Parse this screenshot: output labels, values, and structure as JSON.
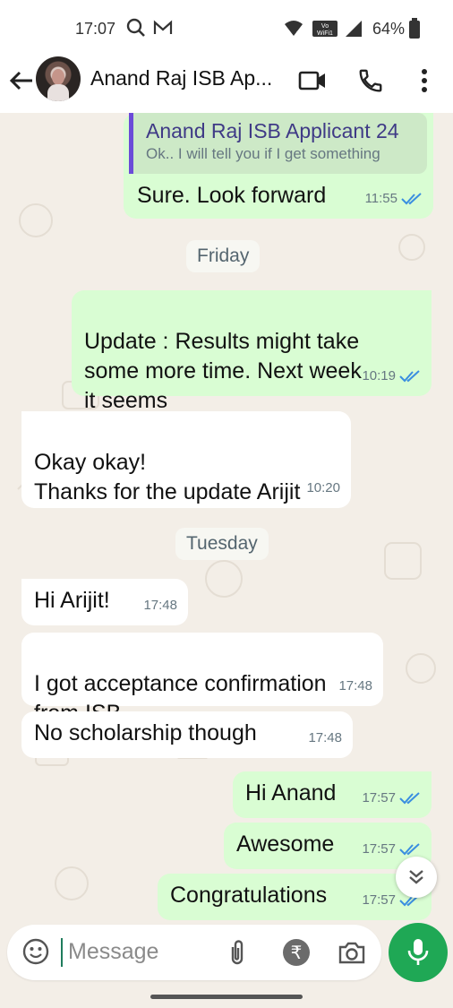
{
  "status_bar": {
    "time": "17:07",
    "battery": "64%",
    "icons": [
      "search-icon",
      "mail-icon",
      "wifi-icon",
      "vowifi-icon",
      "signal-icon",
      "battery-icon"
    ]
  },
  "header": {
    "contact_name": "Anand Raj ISB Ap...",
    "icons": [
      "back-arrow-icon",
      "video-call-icon",
      "phone-icon",
      "more-icon"
    ]
  },
  "messages": [
    {
      "dir": "out",
      "quote_name": "Anand Raj ISB Applicant 24",
      "quote_text": "Ok.. I will tell you if I get something",
      "text": "Sure. Look forward",
      "time": "11:55",
      "status": "read"
    },
    {
      "day": "Friday"
    },
    {
      "dir": "out",
      "text": "Update : Results might take\nsome more time. Next week\nit seems",
      "time": "10:19",
      "status": "read"
    },
    {
      "dir": "in",
      "text": "Okay okay!\nThanks for the update Arijit",
      "time": "10:20"
    },
    {
      "day": "Tuesday"
    },
    {
      "dir": "in",
      "text": "Hi Arijit!",
      "time": "17:48"
    },
    {
      "dir": "in",
      "text": "I got acceptance confirmation\nfrom ISB",
      "time": "17:48"
    },
    {
      "dir": "in",
      "text": "No scholarship though",
      "time": "17:48"
    },
    {
      "dir": "out",
      "text": "Hi Anand",
      "time": "17:57",
      "status": "read"
    },
    {
      "dir": "out",
      "text": "Awesome",
      "time": "17:57",
      "status": "read"
    },
    {
      "dir": "out",
      "text": "Congratulations",
      "time": "17:57",
      "status": "read"
    }
  ],
  "composer": {
    "placeholder": "Message",
    "icons": [
      "emoji-icon",
      "attach-icon",
      "rupee-icon",
      "camera-icon",
      "mic-icon"
    ]
  },
  "colors": {
    "outgoing": "#d9fdd3",
    "incoming": "#ffffff",
    "chat_bg": "#f3eee7",
    "accent": "#1fa855",
    "read_ticks": "#3a8ee0"
  }
}
